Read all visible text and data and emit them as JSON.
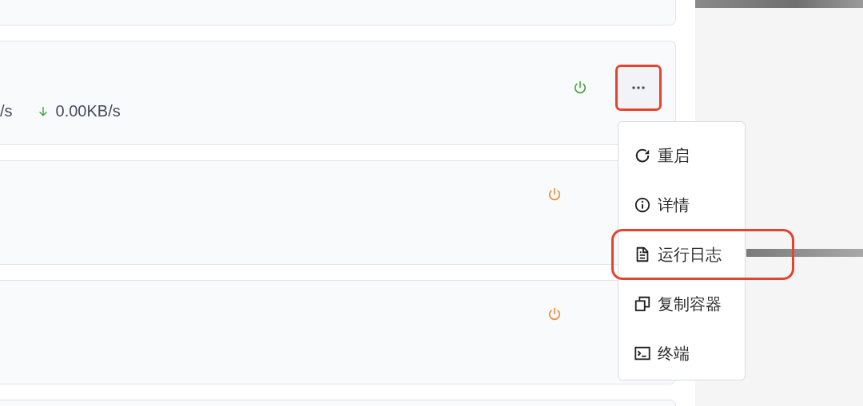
{
  "cards": [
    {
      "kind": "edge"
    },
    {
      "kind": "full",
      "color": "#46a83c",
      "upload": "/s",
      "download": "0.00KB/s",
      "more_annotated": true
    },
    {
      "kind": "full",
      "color": "#ee8f38"
    },
    {
      "kind": "full",
      "color": "#ee8f38"
    },
    {
      "kind": "edge"
    }
  ],
  "menu": {
    "items": [
      {
        "kind": "restart",
        "label": "重启",
        "annotated": false
      },
      {
        "kind": "info",
        "label": "详情",
        "annotated": false
      },
      {
        "kind": "document",
        "label": "运行日志",
        "annotated": true
      },
      {
        "kind": "copy",
        "label": "复制容器",
        "annotated": false
      },
      {
        "kind": "terminal",
        "label": "终端",
        "annotated": false
      }
    ]
  }
}
